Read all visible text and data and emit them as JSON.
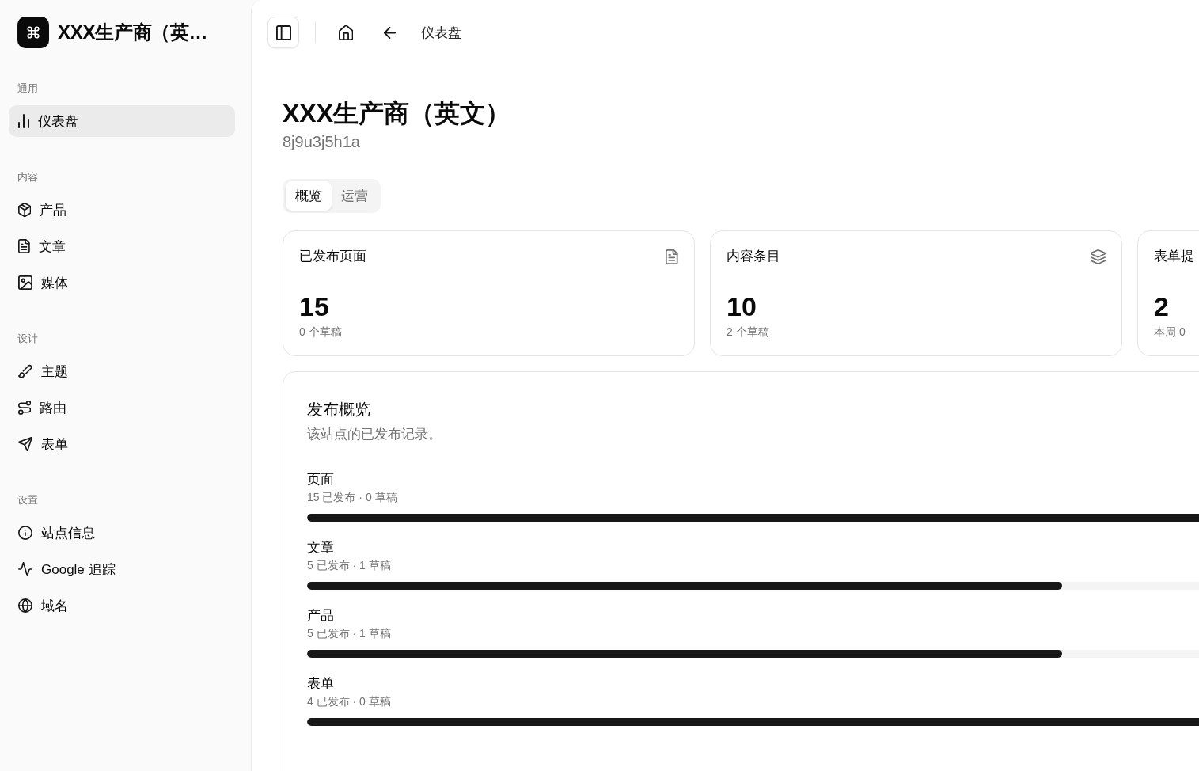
{
  "sidebar": {
    "brand": {
      "title": "XXX生产商（英…"
    },
    "sections": [
      {
        "heading": "通用",
        "items": [
          {
            "label": "仪表盘",
            "selected": true
          }
        ]
      },
      {
        "heading": "内容",
        "items": [
          {
            "label": "产品",
            "selected": false
          },
          {
            "label": "文章",
            "selected": false
          },
          {
            "label": "媒体",
            "selected": false
          }
        ]
      },
      {
        "heading": "设计",
        "items": [
          {
            "label": "主题",
            "selected": false
          },
          {
            "label": "路由",
            "selected": false
          },
          {
            "label": "表单",
            "selected": false
          }
        ]
      },
      {
        "heading": "设置",
        "items": [
          {
            "label": "站点信息",
            "selected": false
          },
          {
            "label": "Google 追踪",
            "selected": false
          },
          {
            "label": "域名",
            "selected": false
          }
        ]
      }
    ]
  },
  "header": {
    "breadcrumb": "仪表盘"
  },
  "page": {
    "title": "XXX生产商（英文）",
    "subtitle": "8j9u3j5h1a"
  },
  "tabs": [
    {
      "label": "概览",
      "selected": true
    },
    {
      "label": "运营",
      "selected": false
    }
  ],
  "stat_cards": [
    {
      "label": "已发布页面",
      "value": "15",
      "note": "0 个草稿"
    },
    {
      "label": "内容条目",
      "value": "10",
      "note": "2 个草稿"
    },
    {
      "label": "表单提",
      "value": "2",
      "note": "本周 0"
    }
  ],
  "overview": {
    "title": "发布概览",
    "description": "该站点的已发布记录。",
    "rows": [
      {
        "label": "页面",
        "summary": "15 已发布 · 0 草稿",
        "level": 1
      },
      {
        "label": "文章",
        "summary": "5 已发布 · 1 草稿",
        "level": 0.62
      },
      {
        "label": "产品",
        "summary": "5 已发布 · 1 草稿",
        "level": 0.62
      },
      {
        "label": "表单",
        "summary": "4 已发布 · 0 草稿",
        "level": 1
      }
    ]
  }
}
